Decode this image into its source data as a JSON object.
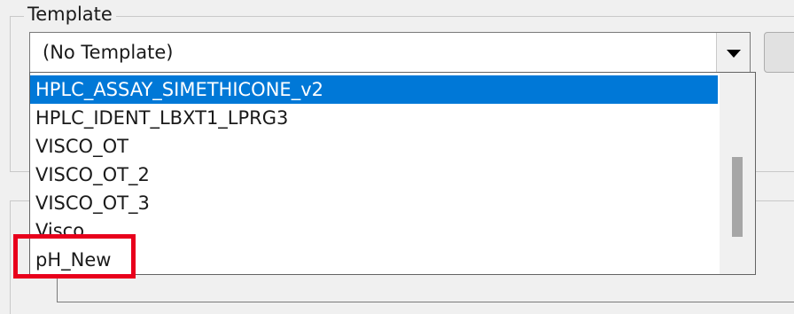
{
  "group": {
    "title": "Template"
  },
  "combo": {
    "selected_value": "(No Template)"
  },
  "dropdown": {
    "items": [
      {
        "label": "HPLC_ASSAY_SIMETHICONE_v2",
        "selected": true
      },
      {
        "label": "HPLC_IDENT_LBXT1_LPRG3",
        "selected": false
      },
      {
        "label": "VISCO_OT",
        "selected": false
      },
      {
        "label": "VISCO_OT_2",
        "selected": false
      },
      {
        "label": "VISCO_OT_3",
        "selected": false
      },
      {
        "label": "Visco",
        "selected": false
      },
      {
        "label": "pH_New",
        "selected": false
      }
    ]
  },
  "annotation": {
    "color": "#e8001c"
  },
  "colors": {
    "selection": "#0078d7",
    "background": "#f0f0f0"
  }
}
